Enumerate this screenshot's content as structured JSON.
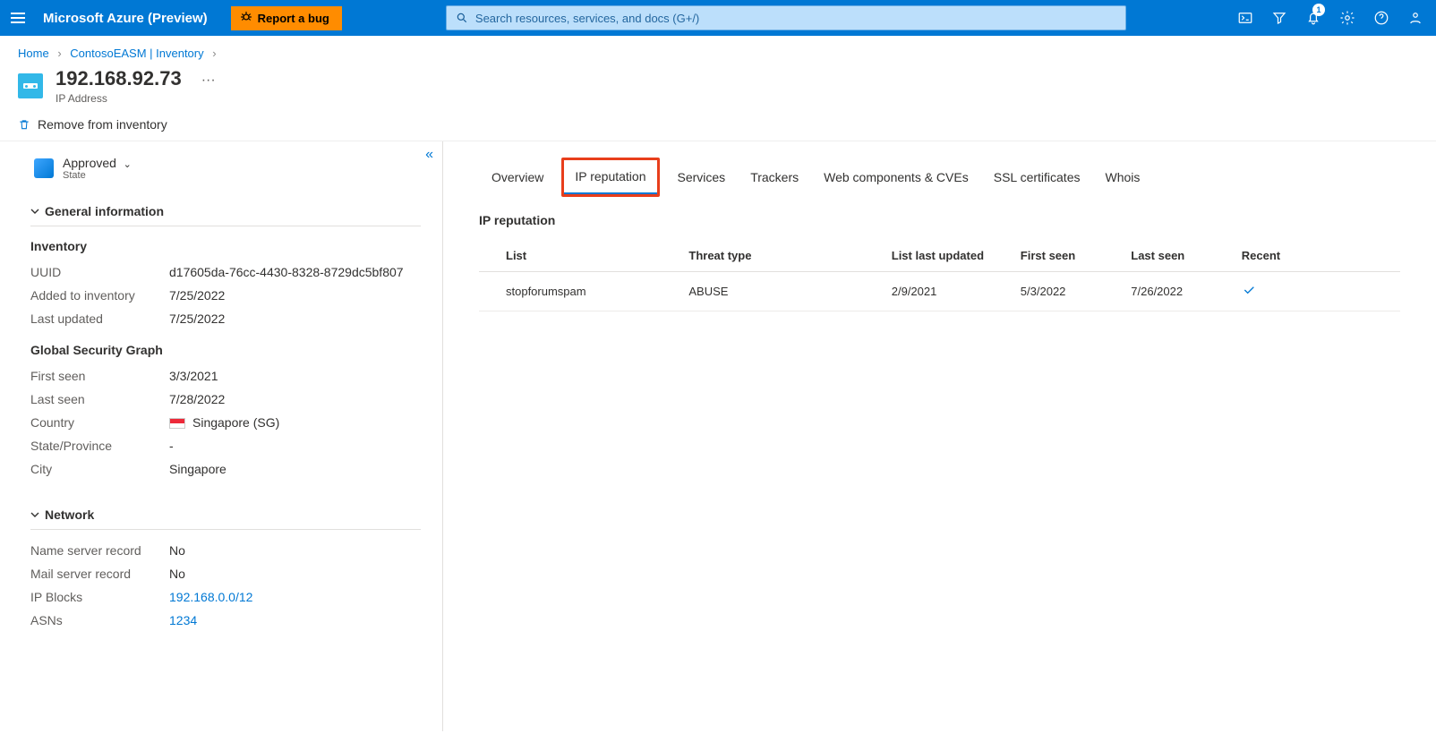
{
  "topbar": {
    "brand": "Microsoft Azure (Preview)",
    "bug_label": "Report a bug",
    "search_placeholder": "Search resources, services, and docs (G+/)",
    "notification_count": "1"
  },
  "breadcrumb": {
    "items": [
      "Home",
      "ContosoEASM | Inventory"
    ]
  },
  "page": {
    "title": "192.168.92.73",
    "subtitle": "IP Address"
  },
  "commands": {
    "remove": "Remove from inventory"
  },
  "state": {
    "label": "Approved",
    "sub": "State"
  },
  "sections": {
    "general": "General information",
    "network": "Network"
  },
  "inventory": {
    "header": "Inventory",
    "uuid_k": "UUID",
    "uuid_v": "d17605da-76cc-4430-8328-8729dc5bf807",
    "added_k": "Added to inventory",
    "added_v": "7/25/2022",
    "updated_k": "Last updated",
    "updated_v": "7/25/2022"
  },
  "gsg": {
    "header": "Global Security Graph",
    "first_k": "First seen",
    "first_v": "3/3/2021",
    "last_k": "Last seen",
    "last_v": "7/28/2022",
    "country_k": "Country",
    "country_v": "Singapore (SG)",
    "state_k": "State/Province",
    "state_v": "-",
    "city_k": "City",
    "city_v": "Singapore"
  },
  "network": {
    "ns_k": "Name server record",
    "ns_v": "No",
    "mail_k": "Mail server record",
    "mail_v": "No",
    "blocks_k": "IP Blocks",
    "blocks_v": "192.168.0.0/12",
    "asn_k": "ASNs",
    "asn_v": "1234"
  },
  "tabs": [
    "Overview",
    "IP reputation",
    "Services",
    "Trackers",
    "Web components & CVEs",
    "SSL certificates",
    "Whois"
  ],
  "panel": {
    "title": "IP reputation",
    "headers": [
      "List",
      "Threat type",
      "List last updated",
      "First seen",
      "Last seen",
      "Recent"
    ],
    "rows": [
      {
        "list": "stopforumspam",
        "threat": "ABUSE",
        "updated": "2/9/2021",
        "first": "5/3/2022",
        "last": "7/26/2022",
        "recent": "✓"
      }
    ]
  }
}
